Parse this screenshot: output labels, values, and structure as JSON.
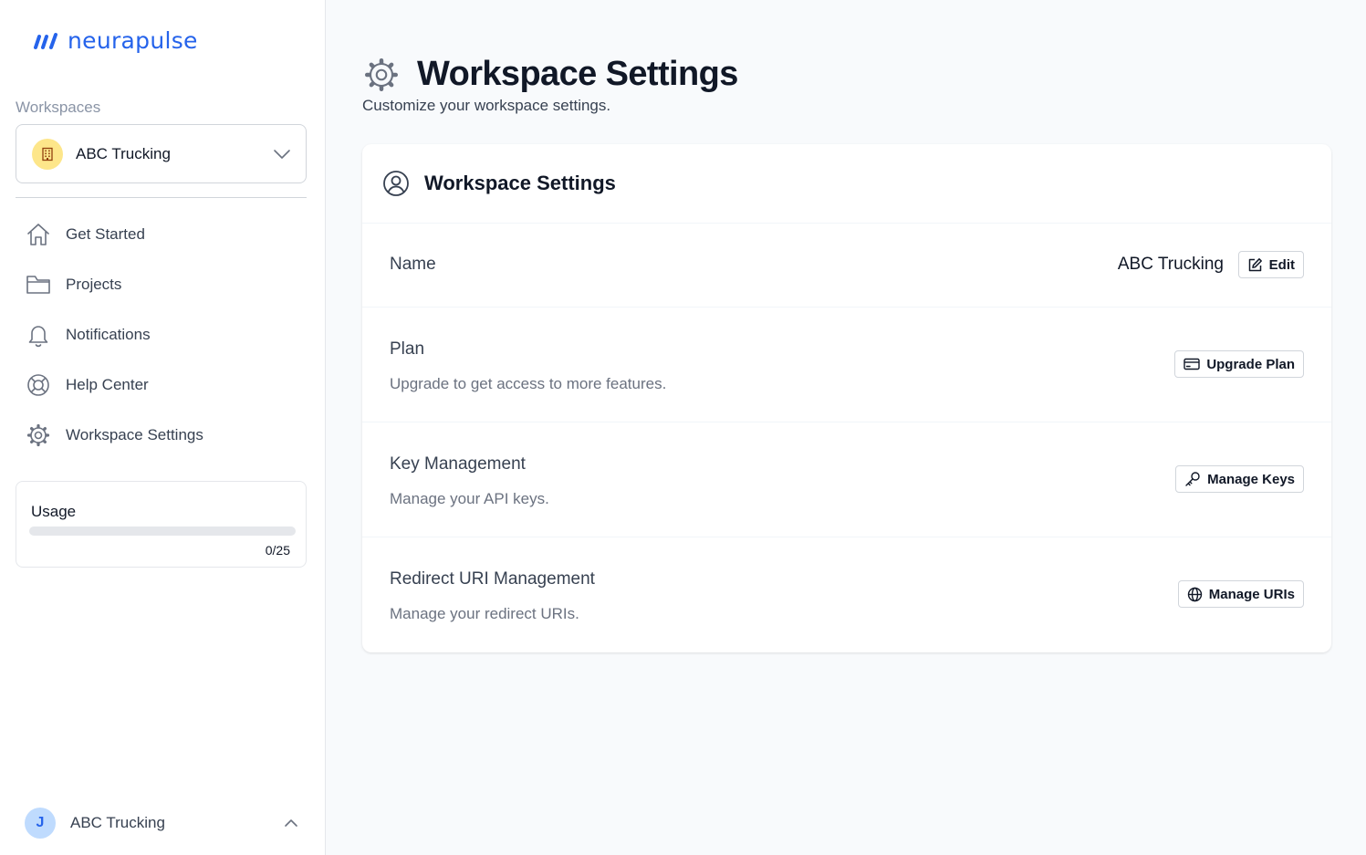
{
  "brand": {
    "name": "neurapulse",
    "color": "#2563eb"
  },
  "sidebar": {
    "workspaces_label": "Workspaces",
    "selected_workspace": {
      "name": "ABC Trucking",
      "icon": "building-icon"
    },
    "nav": [
      {
        "label": "Get Started",
        "icon": "home-icon"
      },
      {
        "label": "Projects",
        "icon": "folder-icon"
      },
      {
        "label": "Notifications",
        "icon": "bell-icon"
      },
      {
        "label": "Help Center",
        "icon": "lifebuoy-icon"
      },
      {
        "label": "Workspace Settings",
        "icon": "gear-icon"
      }
    ],
    "usage": {
      "title": "Usage",
      "count": "0/25",
      "fraction": 0
    },
    "user": {
      "initial": "J",
      "name": "ABC Trucking"
    }
  },
  "page": {
    "title": "Workspace Settings",
    "subtitle": "Customize your workspace settings."
  },
  "card": {
    "title": "Workspace Settings",
    "name_row": {
      "label": "Name",
      "value": "ABC Trucking",
      "button": "Edit"
    },
    "plan_row": {
      "label": "Plan",
      "description": "Upgrade to get access to more features.",
      "button": "Upgrade Plan"
    },
    "keys_row": {
      "label": "Key Management",
      "description": "Manage your API keys.",
      "button": "Manage Keys"
    },
    "uris_row": {
      "label": "Redirect URI Management",
      "description": "Manage your redirect URIs.",
      "button": "Manage URIs"
    }
  }
}
